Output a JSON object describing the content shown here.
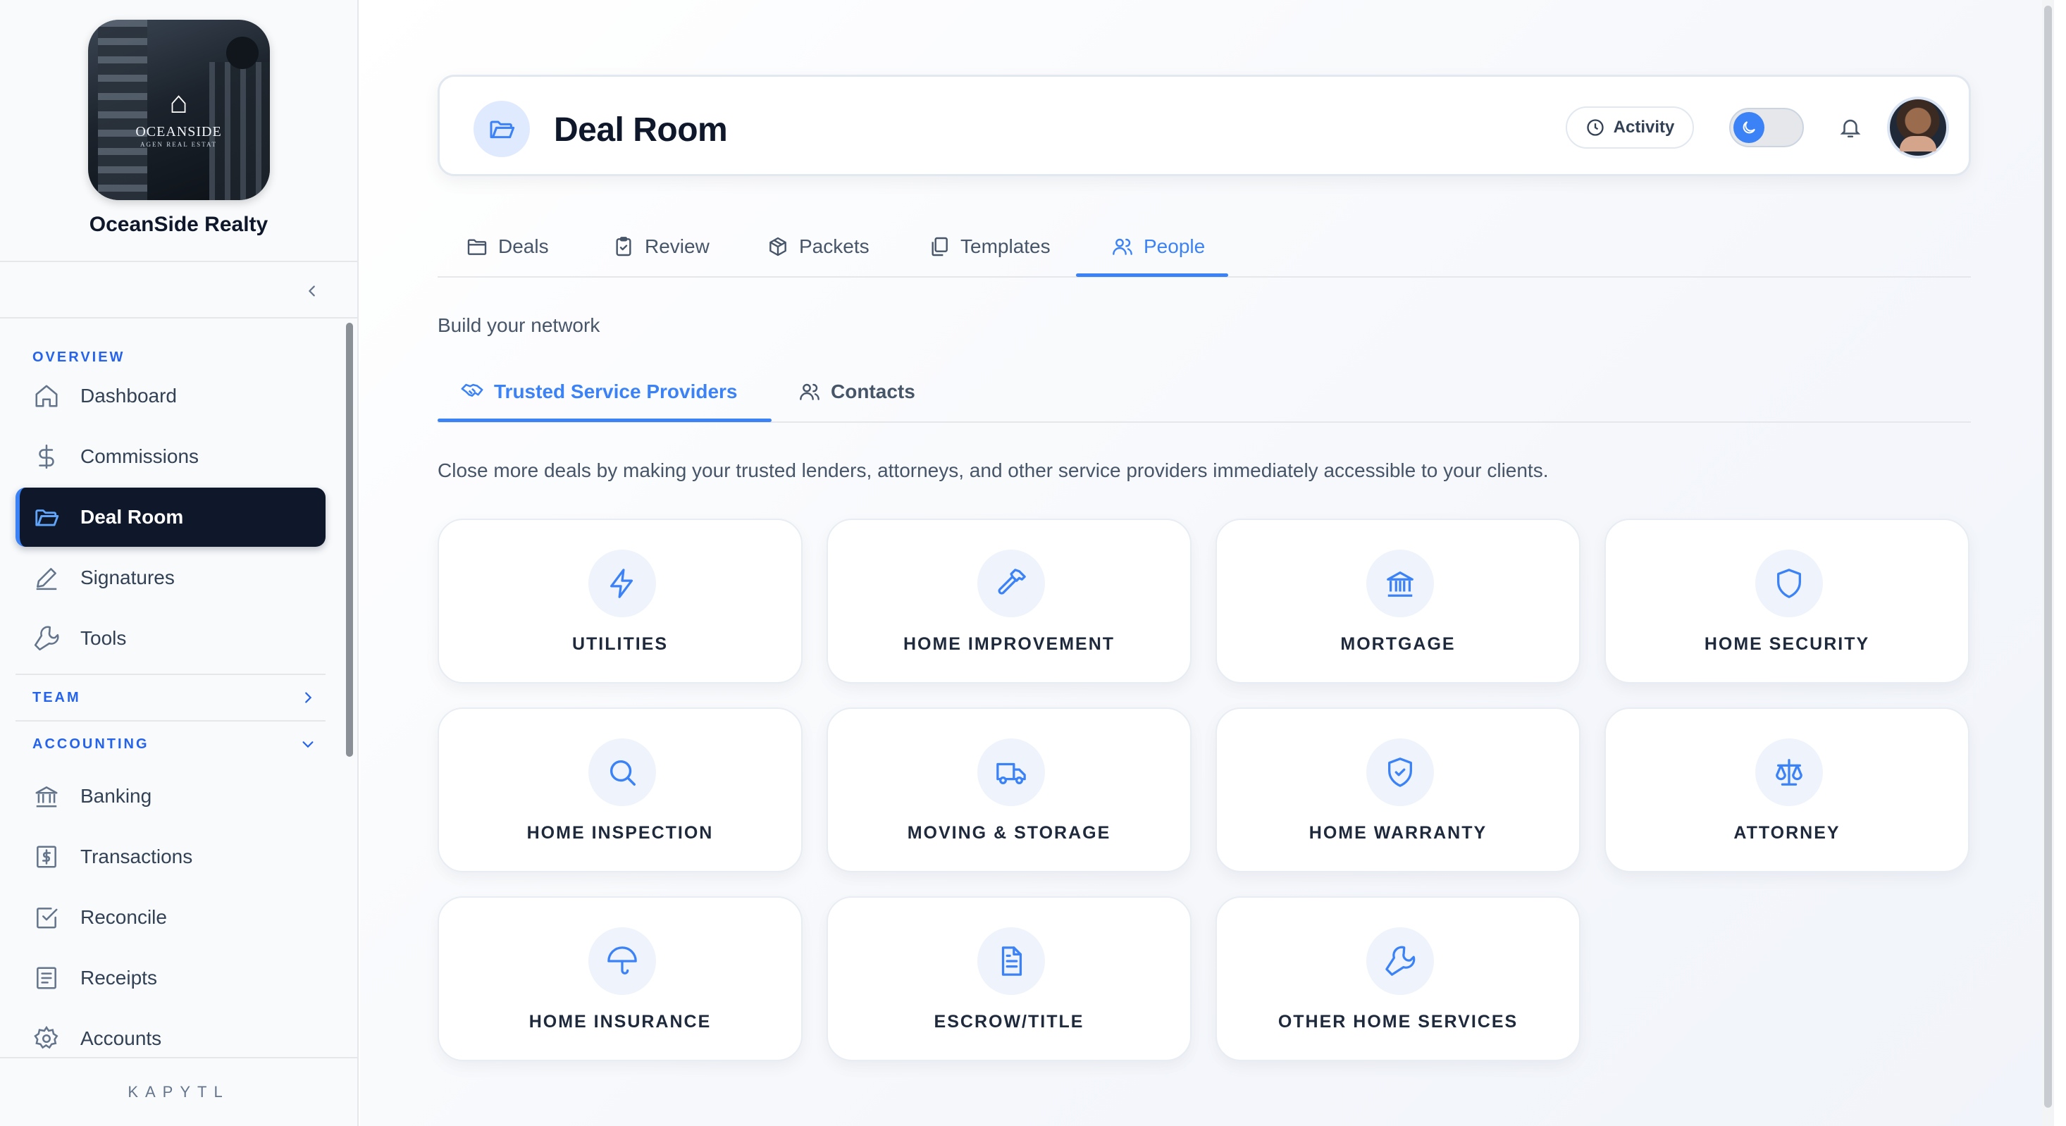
{
  "sidebar": {
    "company_name": "OceanSide Realty",
    "logo_text": "OCEANSIDE",
    "logo_subtext": "AGEN REAL ESTAT",
    "sections": {
      "overview": "OVERVIEW",
      "team": "TEAM",
      "accounting": "ACCOUNTING"
    },
    "overview_items": [
      {
        "label": "Dashboard",
        "icon": "home-icon"
      },
      {
        "label": "Commissions",
        "icon": "dollar-icon"
      },
      {
        "label": "Deal Room",
        "icon": "folder-open-icon",
        "active": true
      },
      {
        "label": "Signatures",
        "icon": "pen-icon"
      },
      {
        "label": "Tools",
        "icon": "wrench-icon"
      }
    ],
    "accounting_items": [
      {
        "label": "Banking",
        "icon": "bank-icon"
      },
      {
        "label": "Transactions",
        "icon": "receipt-dollar-icon"
      },
      {
        "label": "Reconcile",
        "icon": "check-square-icon"
      },
      {
        "label": "Receipts",
        "icon": "receipt-icon"
      },
      {
        "label": "Accounts",
        "icon": "gear-icon"
      }
    ],
    "footer": "KAPYTL"
  },
  "header": {
    "title": "Deal Room",
    "activity_label": "Activity"
  },
  "tabs": [
    {
      "label": "Deals",
      "icon": "folder-icon"
    },
    {
      "label": "Review",
      "icon": "clipboard-check-icon"
    },
    {
      "label": "Packets",
      "icon": "package-icon"
    },
    {
      "label": "Templates",
      "icon": "copy-icon"
    },
    {
      "label": "People",
      "icon": "users-icon",
      "active": true
    }
  ],
  "subtitle": "Build your network",
  "subtabs": [
    {
      "label": "Trusted Service Providers",
      "icon": "handshake-icon",
      "active": true
    },
    {
      "label": "Contacts",
      "icon": "users-icon"
    }
  ],
  "description": "Close more deals by making your trusted lenders, attorneys, and other service providers immediately accessible to your clients.",
  "providers": [
    {
      "label": "UTILITIES",
      "icon": "lightning-icon"
    },
    {
      "label": "HOME IMPROVEMENT",
      "icon": "hammer-icon"
    },
    {
      "label": "MORTGAGE",
      "icon": "bank-icon"
    },
    {
      "label": "HOME SECURITY",
      "icon": "shield-icon"
    },
    {
      "label": "HOME INSPECTION",
      "icon": "search-icon"
    },
    {
      "label": "MOVING & STORAGE",
      "icon": "truck-icon"
    },
    {
      "label": "HOME WARRANTY",
      "icon": "shield-check-icon"
    },
    {
      "label": "ATTORNEY",
      "icon": "scale-icon"
    },
    {
      "label": "HOME INSURANCE",
      "icon": "umbrella-icon"
    },
    {
      "label": "ESCROW/TITLE",
      "icon": "document-icon"
    },
    {
      "label": "OTHER HOME SERVICES",
      "icon": "wrench-icon"
    }
  ],
  "colors": {
    "accent": "#3b82f6",
    "sidebar_active_bg": "#0f172a",
    "section_label": "#2563eb"
  }
}
